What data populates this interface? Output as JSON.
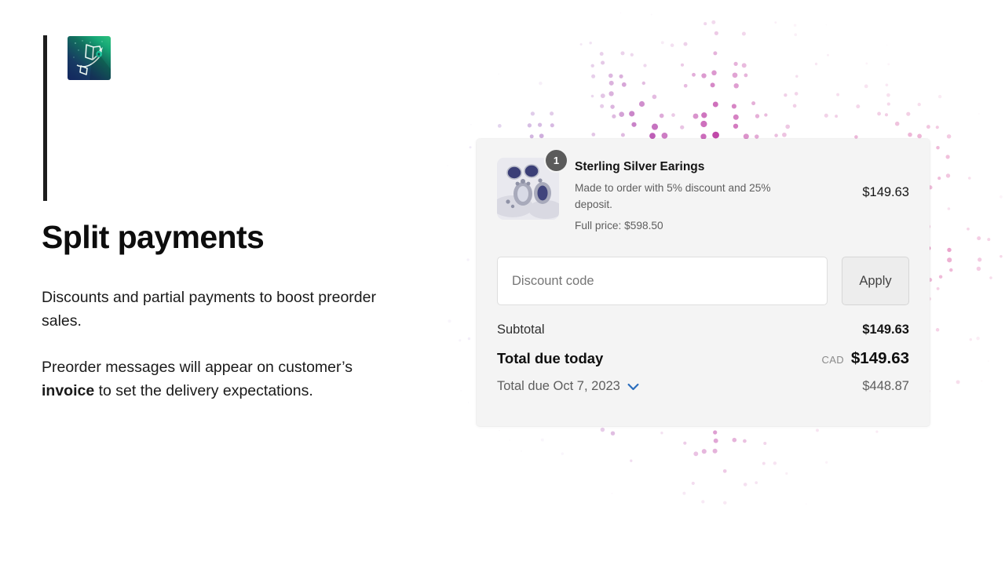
{
  "brand": {
    "logo_icon": "rocket-arrow-logo-icon",
    "accent_bar_color": "#1d1d1d",
    "logo_gradient_from": "#13265e",
    "logo_gradient_to": "#2ec27e"
  },
  "marketing": {
    "headline": "Split payments",
    "paragraph_1": "Discounts and partial payments to boost preorder sales.",
    "paragraph_2_before": "Preorder messages will appear on customer’s ",
    "paragraph_2_bold": "invoice",
    "paragraph_2_after": " to set the delivery expectations."
  },
  "card": {
    "product": {
      "quantity_badge": "1",
      "thumbnail_icon": "earrings-product-image",
      "title": "Sterling Silver Earings",
      "description": "Made to order with 5% discount and 25% deposit.",
      "full_price_label": "Full price: $598.50",
      "line_price": "$149.63"
    },
    "discount": {
      "placeholder": "Discount code",
      "value": "",
      "apply_label": "Apply"
    },
    "totals": {
      "subtotal_label": "Subtotal",
      "subtotal_value": "$149.63",
      "today_label": "Total due today",
      "today_currency": "CAD",
      "today_value": "$149.63",
      "future_label": "Total due Oct 7, 2023",
      "future_value": "$448.87",
      "chevron_icon": "chevron-down-icon",
      "chevron_color": "#2a6dbd"
    }
  },
  "decoration": {
    "dot_pattern_name": "halftone-dot-burst",
    "color_left": "#6b3fb5",
    "color_mid": "#b2249a",
    "color_right": "#cc1f82"
  }
}
